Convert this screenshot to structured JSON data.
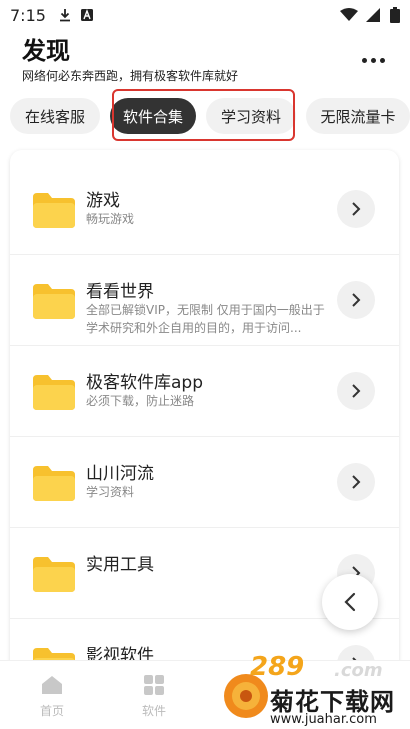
{
  "status_bar": {
    "time": "7:15"
  },
  "header": {
    "title": "发现",
    "subtitle": "网络何必东奔西跑，拥有极客软件库就好"
  },
  "tabs": [
    {
      "label": "在线客服"
    },
    {
      "label": "软件合集"
    },
    {
      "label": "学习资料"
    },
    {
      "label": "无限流量卡"
    }
  ],
  "list": [
    {
      "title": "游戏",
      "desc": "畅玩游戏"
    },
    {
      "title": "看看世界",
      "desc": "全部已解锁VIP，无限制 仅用于国内一般出于学术研究和外企自用的目的，用于访问..."
    },
    {
      "title": "极客软件库app",
      "desc": "必须下载，防止迷路"
    },
    {
      "title": "山川河流",
      "desc": "学习资料"
    },
    {
      "title": "实用工具",
      "desc": ""
    },
    {
      "title": "影视软件",
      "desc": ""
    }
  ],
  "bottom_nav": [
    {
      "label": "首页"
    },
    {
      "label": "软件"
    }
  ],
  "watermark": {
    "number": "289",
    "dotcom": ".com",
    "name": "菊花下载网",
    "url": "www.juahar.com"
  },
  "colors": {
    "accent_dark": "#333333",
    "highlight_red": "#d9362f",
    "folder_yellow": "#fcd34d",
    "folder_tab": "#f7c12e"
  }
}
